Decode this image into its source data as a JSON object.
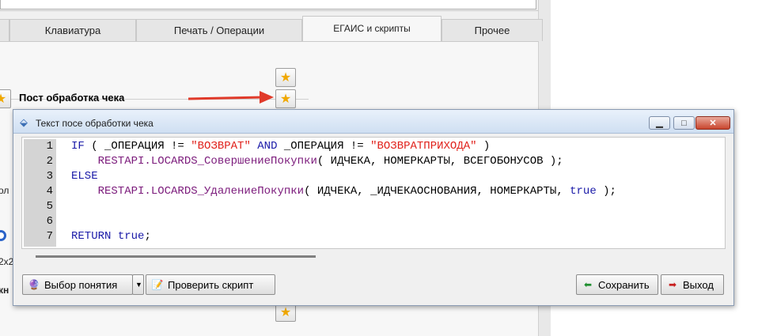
{
  "tabs": [
    {
      "label": "Клавиатура"
    },
    {
      "label": "Печать / Операции"
    },
    {
      "label": "ЕГАИС и скрипты"
    },
    {
      "label": "Прочее"
    }
  ],
  "background": {
    "post_label": "Пост обработка чека",
    "fragment_1": "ол",
    "fragment_2": "2x2",
    "fragment_3": "кн"
  },
  "dialog": {
    "title": "Текст посе обработки чека",
    "code_lines": [
      {
        "num": "1"
      },
      {
        "num": "2"
      },
      {
        "num": "3"
      },
      {
        "num": "4"
      },
      {
        "num": "5"
      },
      {
        "num": "6"
      },
      {
        "num": "7"
      }
    ],
    "code": {
      "l1_if": "IF",
      "l1_a": " ( _ОПЕРАЦИЯ != ",
      "l1_s1": "\"ВОЗВРАТ\"",
      "l1_and": " AND",
      "l1_b": " _ОПЕРАЦИЯ != ",
      "l1_s2": "\"ВОЗВРАТПРИХОДА\"",
      "l1_c": " )",
      "l2_fn": "    RESTAPI.LOCARDS_СовершениеПокупки",
      "l2_args": "( ИДЧЕКА, НОМЕРКАРТЫ, ВСЕГОБОНУСОВ );",
      "l3_else": "ELSE",
      "l4_fn": "    RESTAPI.LOCARDS_УдалениеПокупки",
      "l4_args": "( ИДЧЕКА, _ИДЧЕКАОСНОВАНИЯ, НОМЕРКАРТЫ, ",
      "l4_true": "true",
      "l4_end": " );",
      "l7_return": "RETURN",
      "l7_true": " true",
      "l7_end": ";"
    },
    "buttons": {
      "select_concept": "Выбор понятия",
      "check_script": "Проверить скрипт",
      "save": "Сохранить",
      "exit": "Выход"
    }
  },
  "colors": {
    "keyword": "#1a1aa8",
    "string": "#e0201a",
    "function": "#7b1a7b",
    "arrow": "#e03a2a"
  }
}
